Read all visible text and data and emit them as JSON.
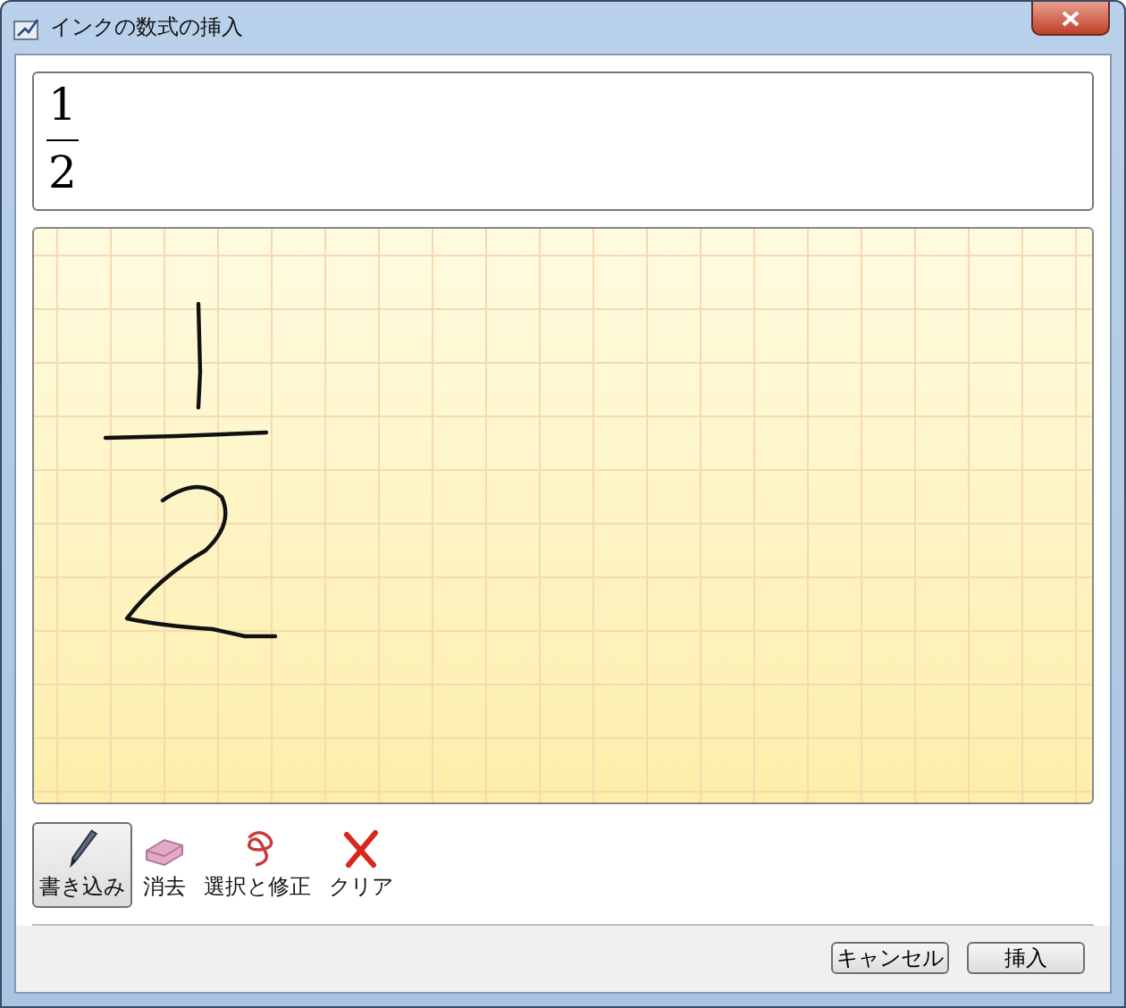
{
  "window": {
    "title": "インクの数式の挿入"
  },
  "preview": {
    "numerator": "1",
    "denominator": "2"
  },
  "tools": [
    {
      "kind": "pen",
      "label": "書き込み",
      "selected": true
    },
    {
      "kind": "eraser",
      "label": "消去",
      "selected": false
    },
    {
      "kind": "lasso",
      "label": "選択と修正",
      "selected": false
    },
    {
      "kind": "clear",
      "label": "クリア",
      "selected": false
    }
  ],
  "buttons": [
    {
      "label": "キャンセル"
    },
    {
      "label": "挿入"
    }
  ]
}
